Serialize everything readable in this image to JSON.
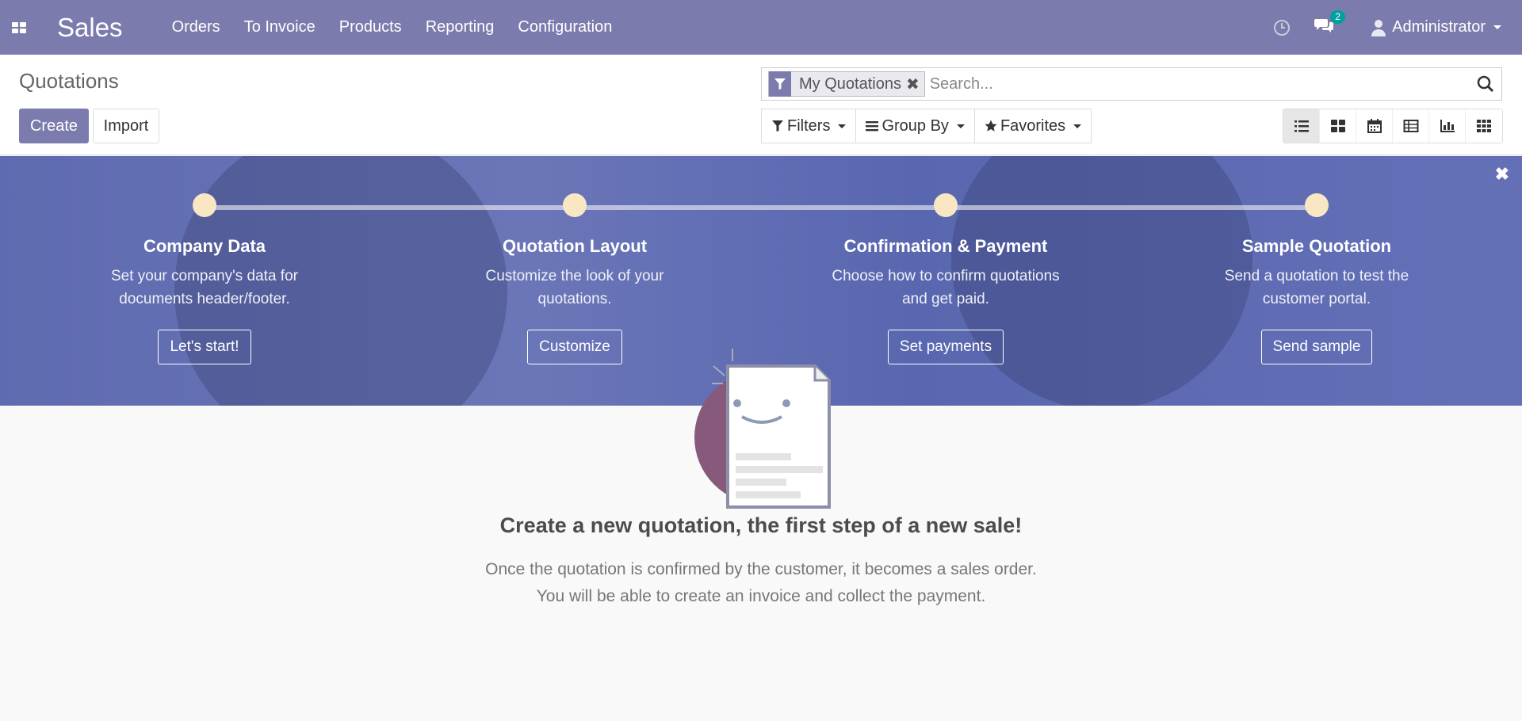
{
  "navbar": {
    "brand": "Sales",
    "menu": [
      "Orders",
      "To Invoice",
      "Products",
      "Reporting",
      "Configuration"
    ],
    "messages_count": "2",
    "user": "Administrator"
  },
  "control_panel": {
    "breadcrumb": "Quotations",
    "create_label": "Create",
    "import_label": "Import",
    "facet_label": "My Quotations",
    "search_placeholder": "Search...",
    "filters_label": "Filters",
    "groupby_label": "Group By",
    "favorites_label": "Favorites"
  },
  "onboarding": {
    "steps": [
      {
        "title": "Company Data",
        "desc1": "Set your company's data for",
        "desc2": "documents header/footer.",
        "button": "Let's start!"
      },
      {
        "title": "Quotation Layout",
        "desc1": "Customize the look of your",
        "desc2": "quotations.",
        "button": "Customize"
      },
      {
        "title": "Confirmation & Payment",
        "desc1": "Choose how to confirm quotations",
        "desc2": "and get paid.",
        "button": "Set payments"
      },
      {
        "title": "Sample Quotation",
        "desc1": "Send a quotation to test the",
        "desc2": "customer portal.",
        "button": "Send sample"
      }
    ]
  },
  "helper": {
    "title": "Create a new quotation, the first step of a new sale!",
    "line1": "Once the quotation is confirmed by the customer, it becomes a sales order.",
    "line2": "You will be able to create an invoice and collect the payment."
  },
  "icons": [
    "apps-icon",
    "clock-icon",
    "chat-icon",
    "user-icon",
    "filter-icon",
    "search-icon",
    "star-icon",
    "list-icon",
    "kanban-icon",
    "calendar-icon",
    "pivot-icon",
    "graph-icon",
    "grid-icon",
    "close-icon"
  ],
  "colors": {
    "brand": "#7c7bad",
    "banner": "#6370b5",
    "dot": "#f9e7c4",
    "badge": "#00a09d"
  }
}
